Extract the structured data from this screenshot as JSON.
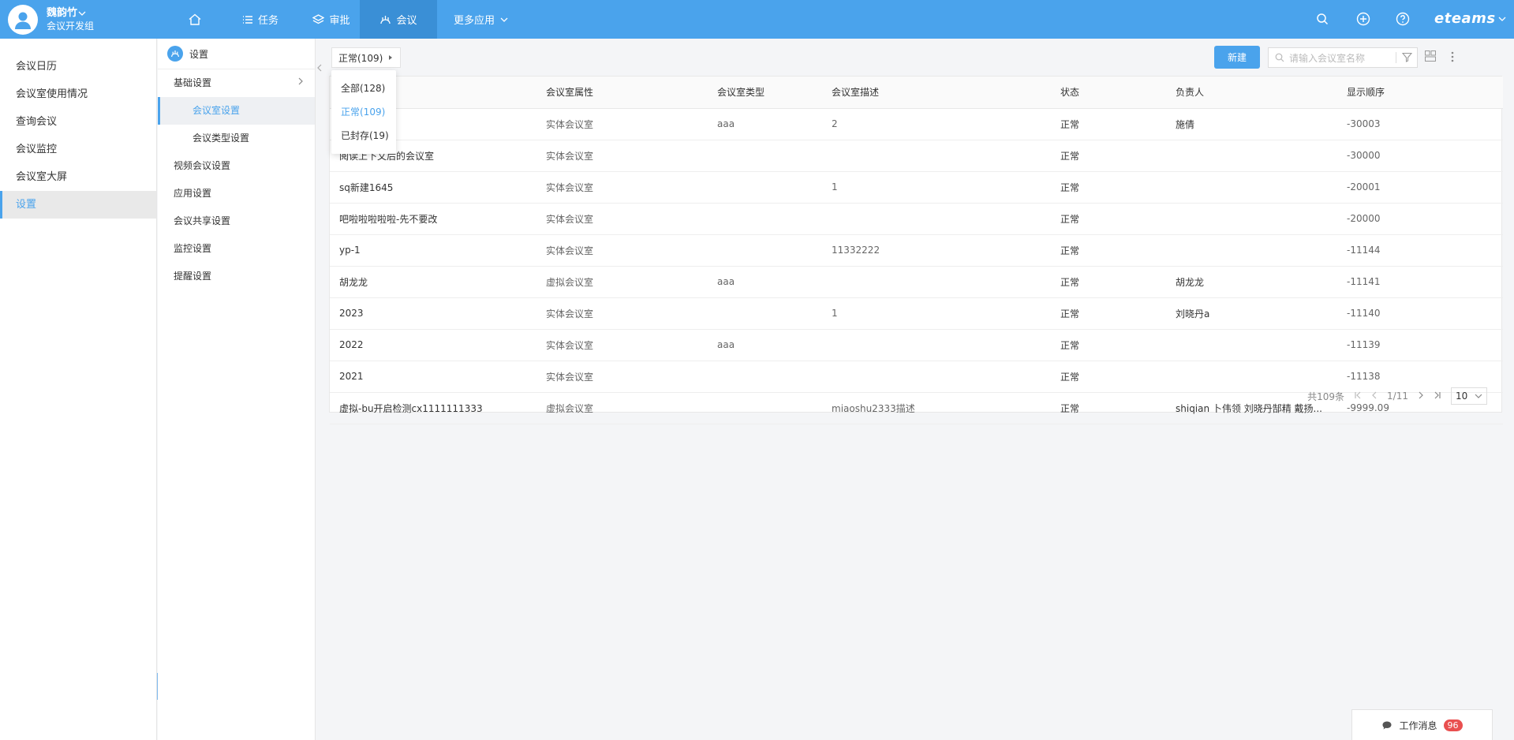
{
  "header": {
    "user_name": "魏韵竹",
    "user_dept": "会议开发组",
    "nav": [
      "任务",
      "审批",
      "会议",
      "更多应用"
    ],
    "brand": "eteams"
  },
  "left_nav": [
    "会议日历",
    "会议室使用情况",
    "查询会议",
    "会议监控",
    "会议室大屏",
    "设置"
  ],
  "sub_nav": {
    "title": "设置",
    "items": [
      "基础设置",
      "会议室设置",
      "会议类型设置",
      "视频会议设置",
      "应用设置",
      "会议共享设置",
      "监控设置",
      "提醒设置"
    ]
  },
  "toolbar": {
    "status_filter": "正常(109)",
    "status_options": [
      "全部(128)",
      "正常(109)",
      "已封存(19)"
    ],
    "new_label": "新建",
    "search_placeholder": "请输入会议室名称"
  },
  "table": {
    "headers": [
      "会议室属性",
      "会议室类型",
      "会议室描述",
      "状态",
      "负责人",
      "显示顺序"
    ],
    "rows": [
      {
        "name": "",
        "attr": "实体会议室",
        "type": "aaa",
        "desc": "2",
        "status": "正常",
        "owner": "施倩",
        "order": "-30003"
      },
      {
        "name": "阅读上下文后的会议室",
        "attr": "实体会议室",
        "type": "",
        "desc": "",
        "status": "正常",
        "owner": "",
        "order": "-30000"
      },
      {
        "name": "sq新建1645",
        "attr": "实体会议室",
        "type": "",
        "desc": "1",
        "status": "正常",
        "owner": "",
        "order": "-20001"
      },
      {
        "name": "吧啦啦啦啦啦-先不要改",
        "attr": "实体会议室",
        "type": "",
        "desc": "",
        "status": "正常",
        "owner": "",
        "order": "-20000"
      },
      {
        "name": "yp-1",
        "attr": "实体会议室",
        "type": "",
        "desc": "11332222",
        "status": "正常",
        "owner": "",
        "order": "-11144"
      },
      {
        "name": "胡龙龙",
        "attr": "虚拟会议室",
        "type": "aaa",
        "desc": "",
        "status": "正常",
        "owner": "胡龙龙",
        "order": "-11141"
      },
      {
        "name": "2023",
        "attr": "实体会议室",
        "type": "",
        "desc": "1",
        "status": "正常",
        "owner": "刘晓丹a",
        "order": "-11140"
      },
      {
        "name": "2022",
        "attr": "实体会议室",
        "type": "aaa",
        "desc": "",
        "status": "正常",
        "owner": "",
        "order": "-11139"
      },
      {
        "name": "2021",
        "attr": "实体会议室",
        "type": "",
        "desc": "",
        "status": "正常",
        "owner": "",
        "order": "-11138"
      },
      {
        "name": "虚拟-bu开启检测cx1111111333",
        "attr": "虚拟会议室",
        "type": "",
        "desc": "miaoshu2333描述",
        "status": "正常",
        "owner": "shiqian  卜伟领  刘晓丹郜精  戴扬...",
        "order": "-9999.09"
      }
    ]
  },
  "pager": {
    "total": "共109条",
    "page": "1/11",
    "size": "10"
  },
  "messages": {
    "label": "工作消息",
    "count": "96"
  }
}
